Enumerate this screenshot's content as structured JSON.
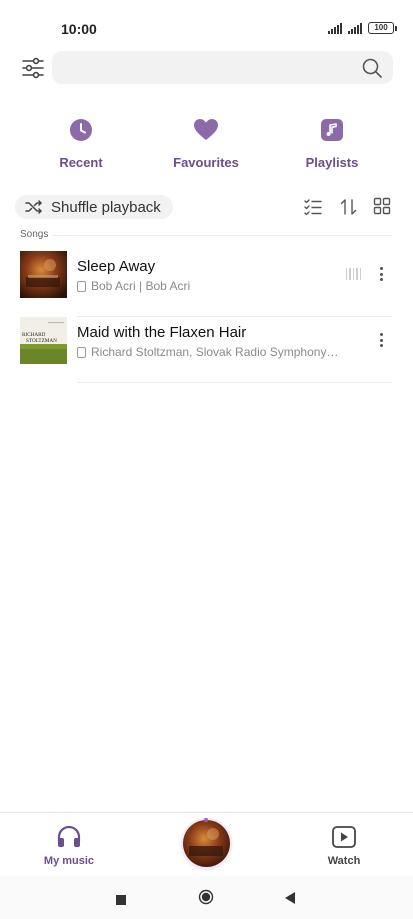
{
  "status_bar": {
    "time": "10:00",
    "battery": "100"
  },
  "search": {
    "placeholder": ""
  },
  "categories": [
    {
      "label": "Recent",
      "icon": "clock-icon"
    },
    {
      "label": "Favourites",
      "icon": "heart-icon"
    },
    {
      "label": "Playlists",
      "icon": "music-note-icon"
    }
  ],
  "toolbar": {
    "shuffle_label": "Shuffle playback"
  },
  "songs_section": {
    "label": "Songs"
  },
  "songs": [
    {
      "title": "Sleep Away",
      "subtitle": "Bob Acri | Bob Acri",
      "playing": true
    },
    {
      "title": "Maid with the Flaxen Hair",
      "subtitle": "Richard Stoltzman, Slovak Radio Symphony…",
      "playing": false
    }
  ],
  "album_art_text": {
    "line1": "RICHARD",
    "line2": "STOLTZMAN"
  },
  "bottom_nav": {
    "my_music": "My music",
    "watch": "Watch"
  },
  "colors": {
    "accent": "#8a6aa8",
    "accent_text": "#6b4e8c"
  }
}
